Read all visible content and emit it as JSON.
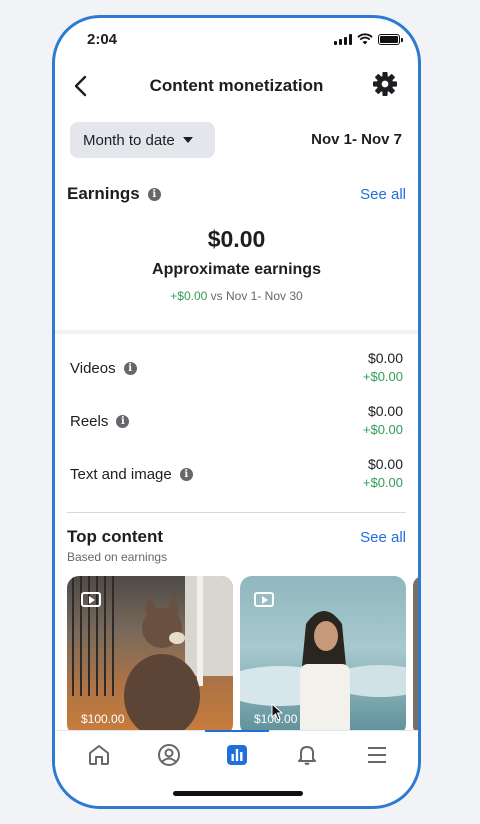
{
  "status_bar": {
    "time": "2:04"
  },
  "header": {
    "title": "Content monetization"
  },
  "filters": {
    "period": "Month to date",
    "date_range": "Nov 1- Nov 7"
  },
  "earnings": {
    "title": "Earnings",
    "see_all": "See all",
    "amount": "$0.00",
    "label": "Approximate earnings",
    "compare_delta": "+$0.00",
    "compare_text": "vs Nov 1- Nov 30"
  },
  "breakdown": [
    {
      "label": "Videos",
      "value": "$0.00",
      "delta": "+$0.00"
    },
    {
      "label": "Reels",
      "value": "$0.00",
      "delta": "+$0.00"
    },
    {
      "label": "Text and image",
      "value": "$0.00",
      "delta": "+$0.00"
    }
  ],
  "top_content": {
    "title": "Top content",
    "subtitle": "Based on earnings",
    "see_all": "See all",
    "cards": [
      {
        "price": "$100.00",
        "icon": "video-icon"
      },
      {
        "price": "$100.00",
        "icon": "video-icon"
      }
    ]
  },
  "bottom_nav": {
    "items": [
      "home-icon",
      "profile-icon",
      "insights-icon",
      "bell-icon",
      "menu-icon"
    ],
    "active": "insights-icon"
  },
  "colors": {
    "accent": "#216fdb",
    "positive": "#2f9e55",
    "frame": "#2d7bd0"
  }
}
